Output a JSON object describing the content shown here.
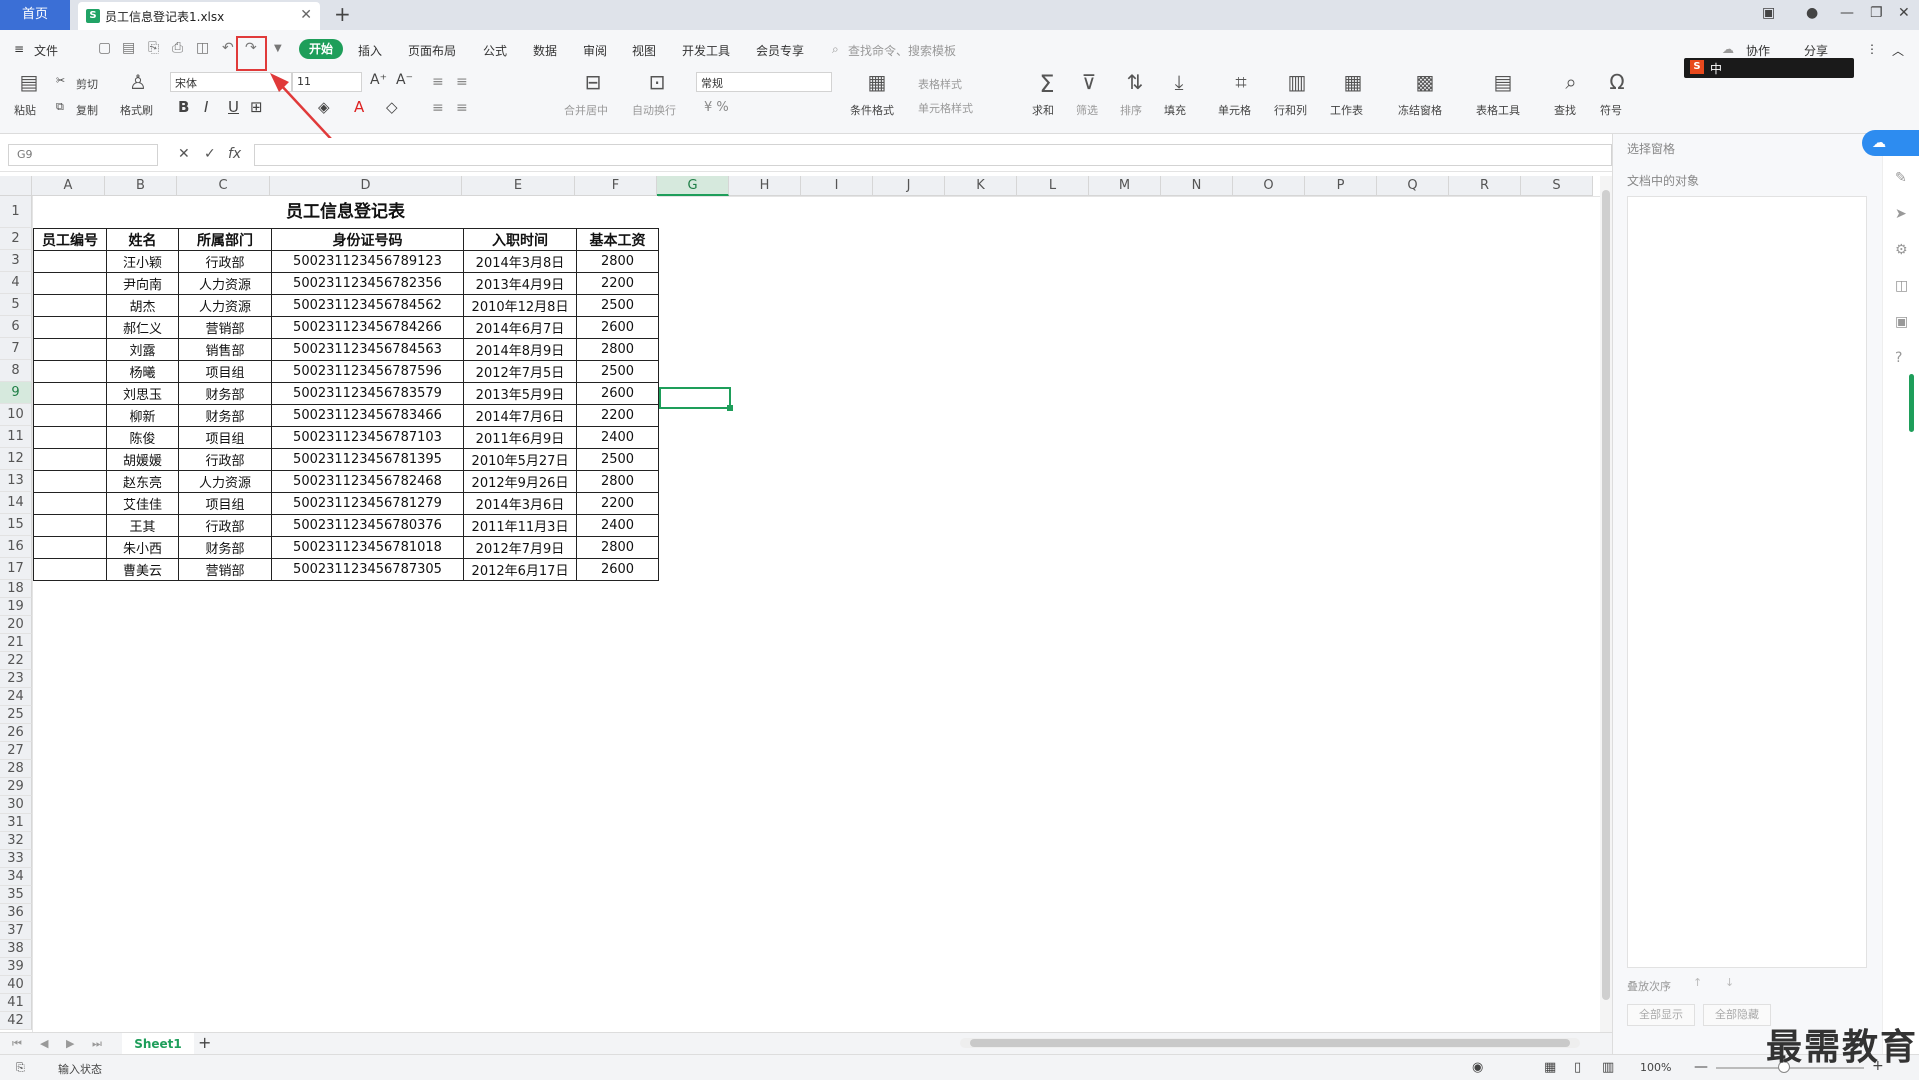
{
  "tabs": {
    "home": "首页",
    "file": "员工信息登记表1.xlsx",
    "file_icon": "S"
  },
  "menu": {
    "file": "文件",
    "start": "开始",
    "items": [
      "插入",
      "页面布局",
      "公式",
      "数据",
      "审阅",
      "视图",
      "开发工具",
      "会员专享"
    ],
    "search": "查找命令、搜索模板",
    "collab": "协作",
    "share": "分享"
  },
  "ribbon": {
    "paste": "粘贴",
    "cut": "剪切",
    "copy": "复制",
    "format_painter": "格式刷",
    "font": "宋体",
    "size": "11",
    "bold": "B",
    "italic": "I",
    "underline": "U",
    "merge": "合并居中",
    "wrap": "自动换行",
    "numfmt": "常规",
    "cond_format": "条件格式",
    "table_style": "表格样式",
    "cell_style": "单元格样式",
    "sum": "求和",
    "filter": "筛选",
    "sort": "排序",
    "fill": "填充",
    "cell": "单元格",
    "rowcol": "行和列",
    "sheet": "工作表",
    "freeze": "冻结窗格",
    "table_tool": "表格工具",
    "find": "查找",
    "symbol": "符号"
  },
  "ime": {
    "logo": "S",
    "lang": "中"
  },
  "formula": {
    "name": "G9",
    "fx": "fx"
  },
  "columns": [
    "A",
    "B",
    "C",
    "D",
    "E",
    "F",
    "G",
    "H",
    "I",
    "J",
    "K",
    "L",
    "M",
    "N",
    "O",
    "P",
    "Q",
    "R",
    "S"
  ],
  "title": "员工信息登记表",
  "headers": [
    "员工编号",
    "姓名",
    "所属部门",
    "身份证号码",
    "入职时间",
    "基本工资"
  ],
  "rows": [
    [
      "",
      "汪小颖",
      "行政部",
      "500231123456789123",
      "2014年3月8日",
      "2800"
    ],
    [
      "",
      "尹向南",
      "人力资源",
      "500231123456782356",
      "2013年4月9日",
      "2200"
    ],
    [
      "",
      "胡杰",
      "人力资源",
      "500231123456784562",
      "2010年12月8日",
      "2500"
    ],
    [
      "",
      "郝仁义",
      "营销部",
      "500231123456784266",
      "2014年6月7日",
      "2600"
    ],
    [
      "",
      "刘露",
      "销售部",
      "500231123456784563",
      "2014年8月9日",
      "2800"
    ],
    [
      "",
      "杨曦",
      "项目组",
      "500231123456787596",
      "2012年7月5日",
      "2500"
    ],
    [
      "",
      "刘思玉",
      "财务部",
      "500231123456783579",
      "2013年5月9日",
      "2600"
    ],
    [
      "",
      "柳新",
      "财务部",
      "500231123456783466",
      "2014年7月6日",
      "2200"
    ],
    [
      "",
      "陈俊",
      "项目组",
      "500231123456787103",
      "2011年6月9日",
      "2400"
    ],
    [
      "",
      "胡媛媛",
      "行政部",
      "500231123456781395",
      "2010年5月27日",
      "2500"
    ],
    [
      "",
      "赵东亮",
      "人力资源",
      "500231123456782468",
      "2012年9月26日",
      "2800"
    ],
    [
      "",
      "艾佳佳",
      "项目组",
      "500231123456781279",
      "2014年3月6日",
      "2200"
    ],
    [
      "",
      "王其",
      "行政部",
      "500231123456780376",
      "2011年11月3日",
      "2400"
    ],
    [
      "",
      "朱小西",
      "财务部",
      "500231123456781018",
      "2012年7月9日",
      "2800"
    ],
    [
      "",
      "曹美云",
      "营销部",
      "500231123456787305",
      "2012年6月17日",
      "2600"
    ]
  ],
  "row_count": 42,
  "sheet": {
    "name": "Sheet1",
    "add": "+"
  },
  "status": {
    "input_state": "输入状态",
    "zoom": "100%"
  },
  "panel": {
    "title": "选择窗格",
    "objects": "文档中的对象",
    "order": "叠放次序",
    "show_all": "全部显示",
    "hide_all": "全部隐藏"
  },
  "watermark": "最需教育",
  "colors": {
    "accent": "#1e9e5a",
    "highlight": "#e03a3a",
    "home_tab": "#3b6fd6"
  }
}
